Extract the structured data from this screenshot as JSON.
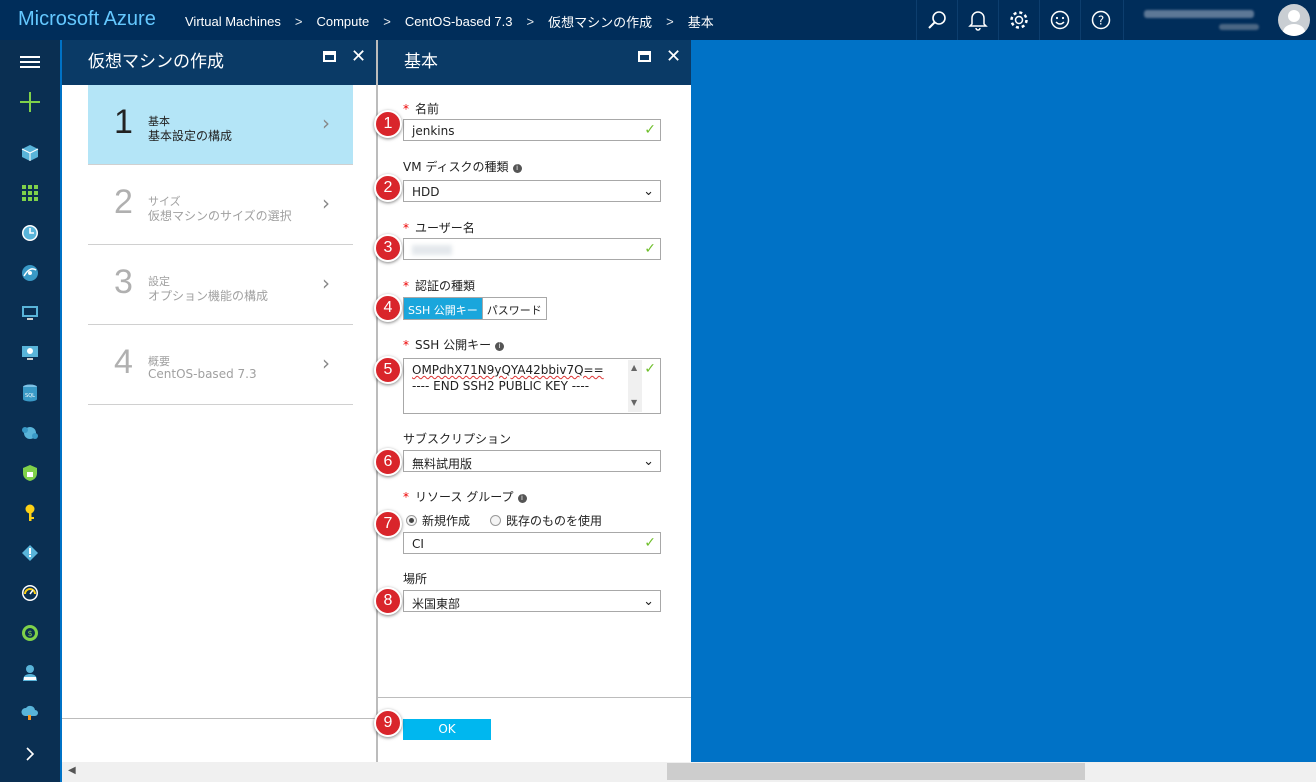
{
  "topbar": {
    "brand": "Microsoft Azure",
    "breadcrumbs": [
      "Virtual Machines",
      "Compute",
      "CentOS-based 7.3",
      "仮想マシンの作成",
      "基本"
    ],
    "icons": [
      "search-icon",
      "bell-icon",
      "gear-icon",
      "smiley-icon",
      "help-icon"
    ]
  },
  "leftnav": {
    "items": [
      "menu-icon",
      "new-plus-icon",
      "resource-groups-icon",
      "all-resources-icon",
      "recent-icon",
      "app-services-icon",
      "virtual-machines-icon",
      "cloud-services-icon",
      "sql-icon",
      "cosmos-icon",
      "security-icon",
      "key-icon",
      "devops-icon",
      "monitor-icon",
      "cost-icon",
      "user-icon",
      "cloud-icon",
      "expand-icon"
    ]
  },
  "blade1": {
    "title": "仮想マシンの作成",
    "steps": [
      {
        "num": "1",
        "title": "基本",
        "subtitle": "基本設定の構成"
      },
      {
        "num": "2",
        "title": "サイズ",
        "subtitle": "仮想マシンのサイズの選択"
      },
      {
        "num": "3",
        "title": "設定",
        "subtitle": "オプション機能の構成"
      },
      {
        "num": "4",
        "title": "概要",
        "subtitle": "CentOS-based 7.3"
      }
    ]
  },
  "blade2": {
    "title": "基本",
    "name_label": "名前",
    "name_value": "jenkins",
    "disk_label": "VM ディスクの種類",
    "disk_value": "HDD",
    "user_label": "ユーザー名",
    "auth_label": "認証の種類",
    "auth_options": [
      "SSH 公開キー",
      "パスワード"
    ],
    "ssh_label": "SSH 公開キー",
    "ssh_line1": "OMPdhX71N9yQYA42bbiv7Q==",
    "ssh_line2": "---- END SSH2 PUBLIC KEY ----",
    "sub_label": "サブスクリプション",
    "sub_value": "無料試用版",
    "rg_label": "リソース グループ",
    "rg_new": "新規作成",
    "rg_existing": "既存のものを使用",
    "rg_value": "CI",
    "loc_label": "場所",
    "loc_value": "米国東部",
    "ok_label": "OK"
  },
  "badges": [
    "1",
    "2",
    "3",
    "4",
    "5",
    "6",
    "7",
    "8",
    "9"
  ],
  "colors": {
    "topbar": "#002d5a",
    "brand": "#64c8ff",
    "nav": "#0a2f52",
    "blade_head": "#0a3a66",
    "active_step": "#b4e5f7",
    "accent": "#00b7ef",
    "badge": "#d9252b",
    "desktop": "#0072c6"
  }
}
